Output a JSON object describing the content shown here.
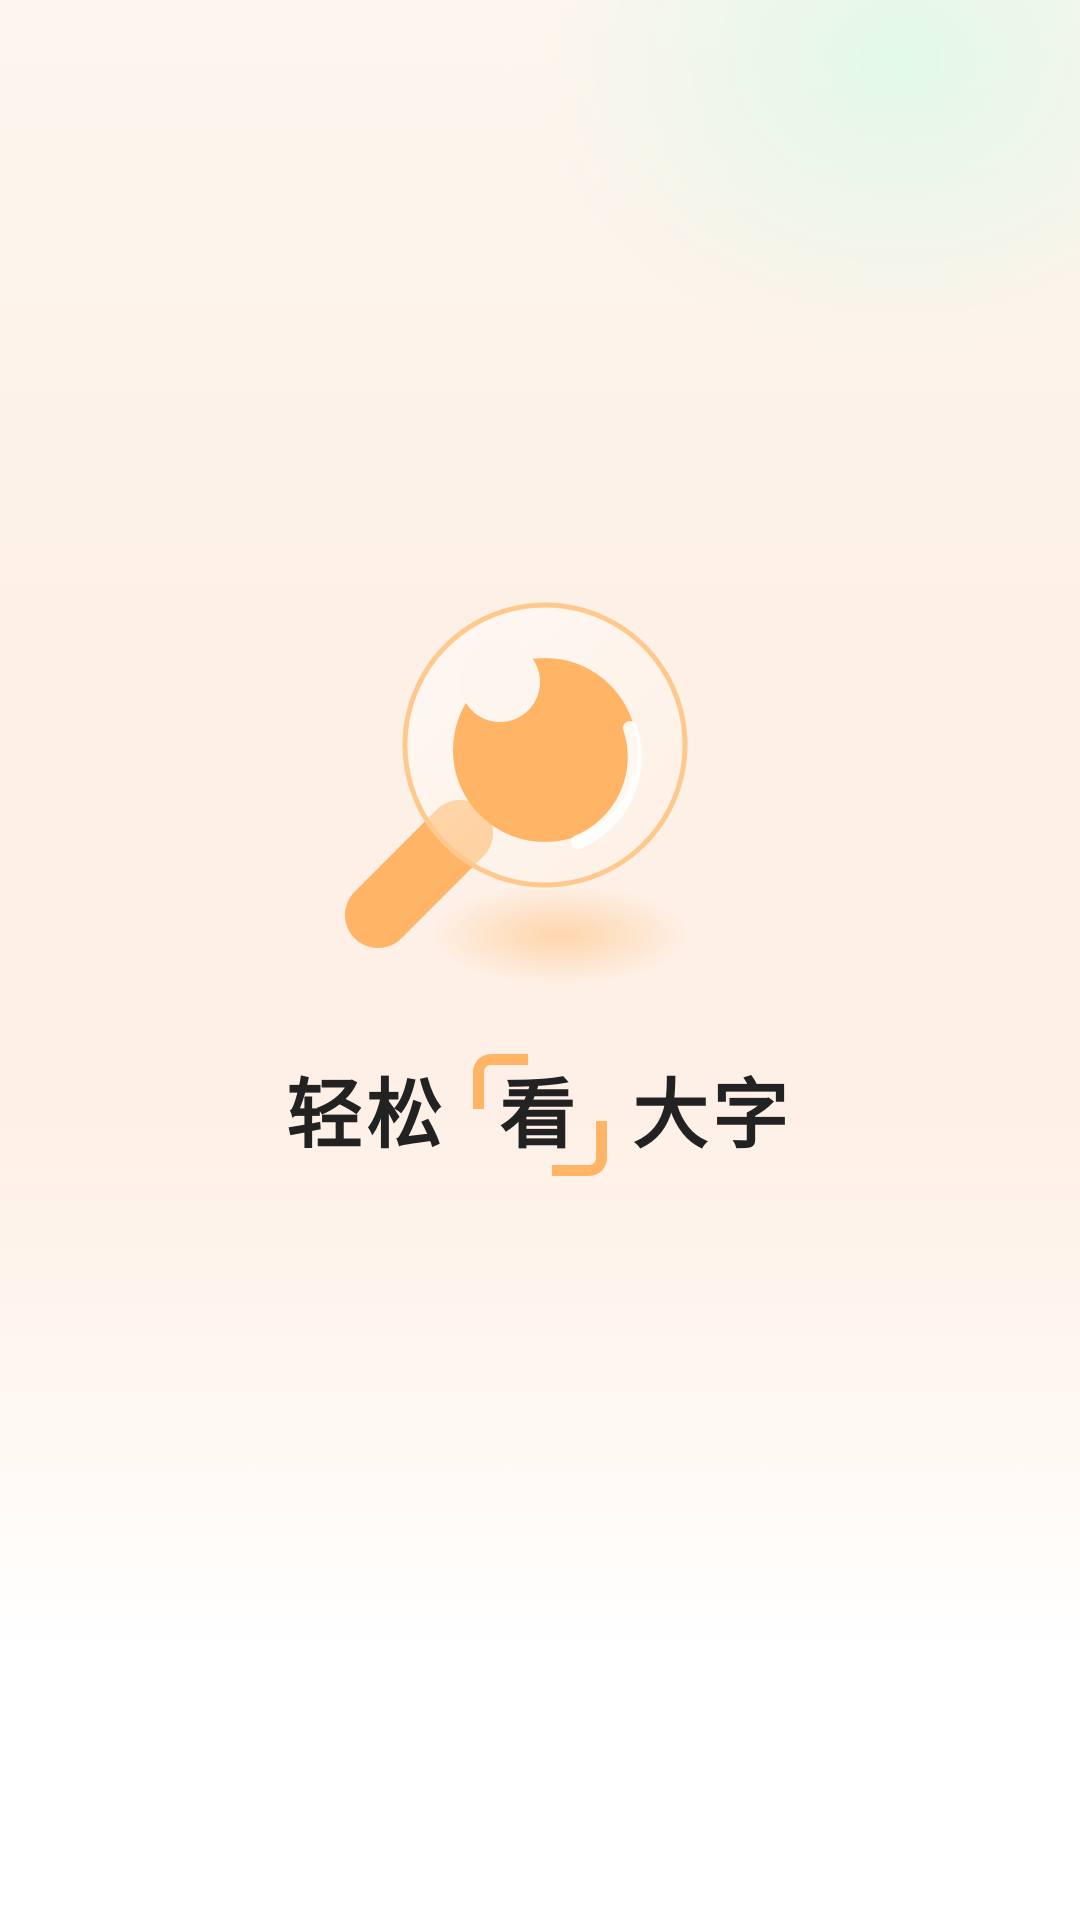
{
  "splash": {
    "logo_icon": "magnifier-eye-icon",
    "slogan": {
      "part1": "轻松",
      "highlight": "看",
      "part2": "大字"
    },
    "accent_color": "#ffb466",
    "text_color": "#222222"
  }
}
